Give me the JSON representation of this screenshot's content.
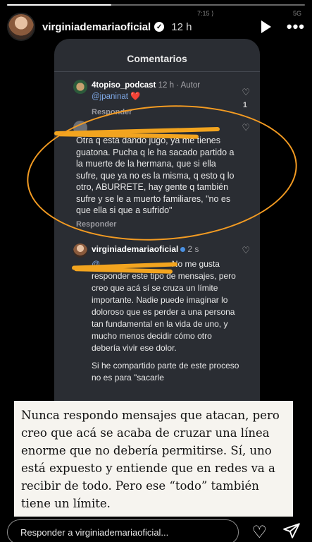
{
  "story": {
    "username": "virginiademariaoficial",
    "time": "12 h",
    "status_bar_partial": "7:15 ⟩",
    "network": "5G",
    "progress_fraction": 0.35
  },
  "screenshot": {
    "title": "Comentarios",
    "comment1": {
      "user": "4topiso_podcast",
      "meta": "12 h · Autor",
      "mention": "@jpaninat",
      "emoji": "❤️",
      "reply": "Responder",
      "likes": "1"
    },
    "comment2": {
      "text": "Otra q está dando jugo, ya me tienes guatona. Pucha q le ha sacado partido a la muerte de la hermana, que si ella sufre, que ya no es la misma, q esto q lo otro, ABURRETE, hay gente q también sufre y se le a muerto familiares, \"no es que ella si que a sufrido\"",
      "reply": "Responder"
    },
    "comment3": {
      "user": "virginiademariaoficial",
      "meta": "2 s",
      "mention": "@",
      "text_a": "No me gusta responder este tipo de mensajes, pero creo que acá sí se cruza un límite importante. Nadie puede imaginar lo doloroso que es perder a una persona tan fundamental en la vida de uno, y mucho menos decidir cómo otro debería vivir ese dolor.",
      "text_b": "Si he compartido parte de este proceso no es para \"sacarle"
    }
  },
  "caption": {
    "text": "Nunca respondo mensajes que atacan, pero creo que acá se acaba de cruzar una línea enorme que no debería permitirse. Sí, uno está expuesto y entiende que en redes va a recibir de todo. Pero ese “todo” también tiene un límite."
  },
  "footer": {
    "reply_placeholder": "Responder a virginiademariaoficial..."
  },
  "colors": {
    "highlight": "#f2a41f",
    "mention": "#7ea8e6"
  }
}
